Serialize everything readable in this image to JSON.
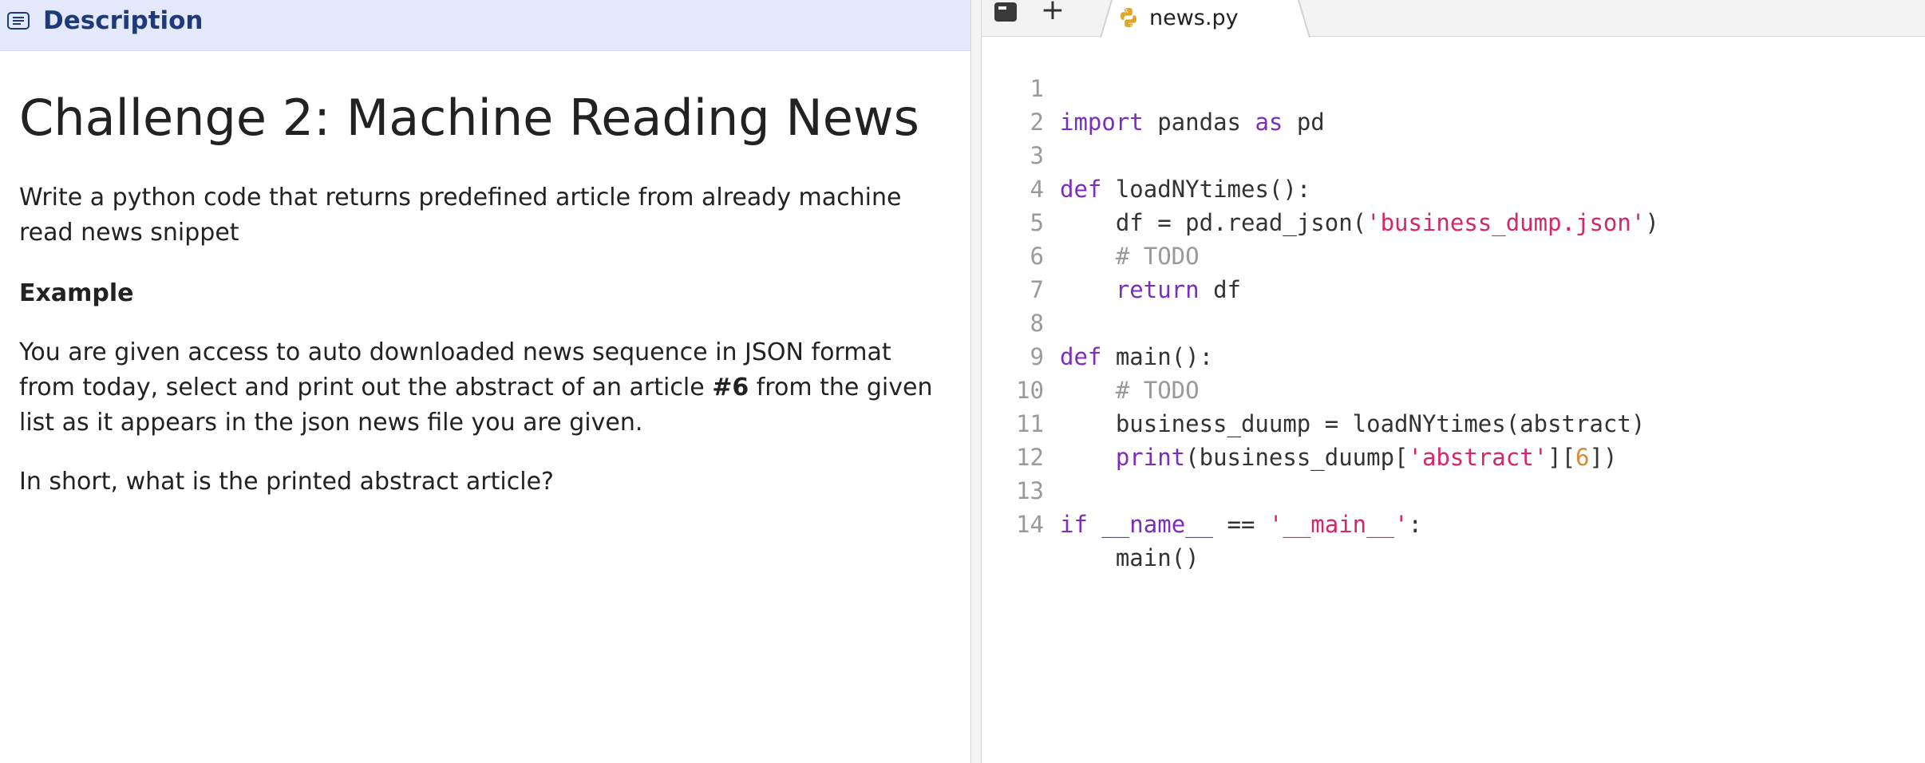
{
  "description_panel": {
    "header_label": "Description",
    "challenge_title": "Challenge 2: Machine Reading News",
    "paragraph_1": "Write a python code that returns predefined article from already machine read news snippet",
    "example_heading": "Example",
    "paragraph_2_before": "You are given access to auto downloaded news sequence in JSON format from today, select and print out the abstract of an article ",
    "paragraph_2_bold": "#6",
    "paragraph_2_after": " from the given list as it appears in the json news file you are given.",
    "paragraph_3": "In short, what is the printed abstract article?",
    "icons": {
      "header": "document-lines-icon"
    }
  },
  "editor": {
    "tab_filename": "news.py",
    "icons": {
      "terminal": "terminal-icon",
      "add": "plus-icon",
      "file": "python-icon"
    },
    "add_glyph": "+",
    "lines": [
      {
        "n": "1"
      },
      {
        "n": "2"
      },
      {
        "n": "3"
      },
      {
        "n": "4"
      },
      {
        "n": "5"
      },
      {
        "n": "6"
      },
      {
        "n": "7"
      },
      {
        "n": "8"
      },
      {
        "n": "9"
      },
      {
        "n": "10"
      },
      {
        "n": "11"
      },
      {
        "n": "12"
      },
      {
        "n": "13"
      },
      {
        "n": "14"
      }
    ],
    "tokens": {
      "l1_import": "import",
      "l1_pandas": " pandas ",
      "l1_as": "as",
      "l1_pd": " pd",
      "l3_def": "def",
      "l3_rest": " loadNYtimes():",
      "l4_a": "    df = pd.read_json(",
      "l4_str": "'business_dump.json'",
      "l4_b": ")",
      "l5_cmt": "    # TODO",
      "l6_indent": "    ",
      "l6_return": "return",
      "l6_rest": " df",
      "l8_def": "def",
      "l8_rest": " main():",
      "l9_cmt": "    # TODO",
      "l10": "    business_duump = loadNYtimes(abstract)",
      "l11_indent": "    ",
      "l11_print": "print",
      "l11_a": "(business_duump[",
      "l11_str": "'abstract'",
      "l11_b": "][",
      "l11_num": "6",
      "l11_c": "])",
      "l13_if": "if",
      "l13_sp": " ",
      "l13_name": "__name__",
      "l13_eq": " == ",
      "l13_str": "'__main__'",
      "l13_colon": ":",
      "l14": "    main()"
    },
    "colors": {
      "keyword": "#7a2dbf",
      "string": "#d6256a",
      "number": "#d88a36",
      "comment": "#9a9a9a"
    }
  }
}
